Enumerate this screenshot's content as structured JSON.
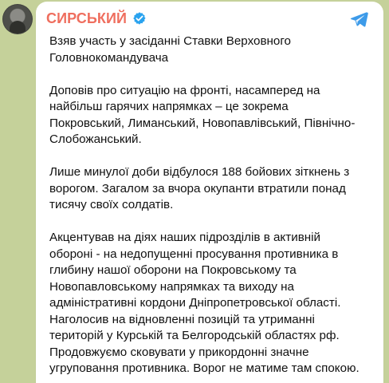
{
  "channel": {
    "name": "СИРСЬКИЙ",
    "verified": true,
    "avatar": "avatar"
  },
  "icons": {
    "verified": "verified-badge-icon",
    "share": "telegram-share-icon"
  },
  "colors": {
    "background": "#c5d19a",
    "channel_name": "#ef6e5e",
    "verified": "#2aa3ef",
    "share": "#3d9be9",
    "text": "#111111",
    "bubble": "#ffffff"
  },
  "message": {
    "paragraphs": [
      "Взяв участь у засіданні Ставки Верховного\nГоловнокомандувача",
      "Доповів про ситуацію на фронті, насамперед на\nнайбільш гарячих напрямках – це зокрема\nПокровський, Лиманський, Новопавлівський, Північно-\nСлобожанський.",
      "Лише минулої доби відбулося 188 бойових зіткнень з\nворогом. Загалом за вчора окупанти втратили понад\nтисячу своїх солдатів.",
      "Акцентував на діях наших підрозділів в активній\nобороні - на недопущенні просування противника в\nглибину нашої оборони на Покровському та\nНовопавловському напрямках та виходу на\nадміністративні кордони Дніпропетровської області.\nНаголосив на відновленні позицій та утриманні\nтериторій у Курській та Белгородській областях рф.\nПродовжуємо сковувати у прикордонні значне\nугруповання противника. Ворог не матиме там спокою."
    ]
  }
}
